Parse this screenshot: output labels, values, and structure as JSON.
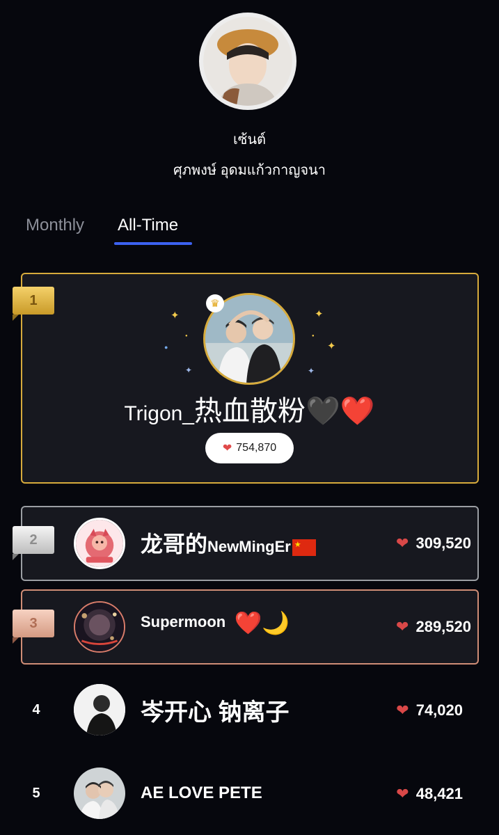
{
  "profile": {
    "nickname": "เซ้นต์",
    "fullname": "ศุภพงษ์ อุดมแก้วกาญจนา"
  },
  "tabs": [
    {
      "label": "Monthly",
      "active": false
    },
    {
      "label": "All-Time",
      "active": true
    }
  ],
  "colors": {
    "accent": "#3c62f0",
    "gold": "#d7ab3c",
    "silver": "#9b9ea3",
    "bronze": "#cf8d76",
    "heart": "#d94848"
  },
  "ranking": [
    {
      "rank": "1",
      "name_prefix": "Trigon_",
      "name_main": "热血散粉",
      "name_suffix": "🖤❤️",
      "score": "754,870"
    },
    {
      "rank": "2",
      "name_main": "龙哥的",
      "name_suffix": "NewMingEr",
      "flag": "china-flag-icon",
      "score": "309,520"
    },
    {
      "rank": "3",
      "name_main": "Supermoon",
      "name_suffix": "❤️🌙",
      "score": "289,520"
    },
    {
      "rank": "4",
      "name_main": "岑开心 钠离子",
      "score": "74,020"
    },
    {
      "rank": "5",
      "name_main": "AE LOVE PETE",
      "score": "48,421"
    }
  ]
}
